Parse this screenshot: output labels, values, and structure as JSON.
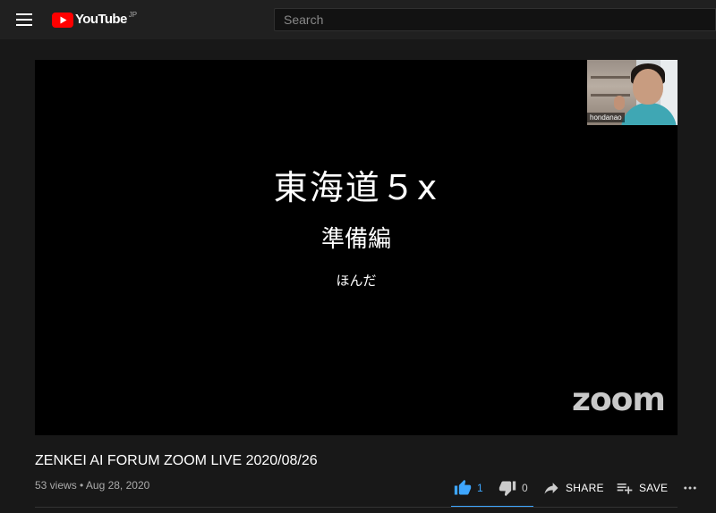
{
  "header": {
    "logo_text": "YouTube",
    "region": "JP",
    "search_placeholder": "Search"
  },
  "player": {
    "slide_title": "東海道５x",
    "slide_subtitle": "準備編",
    "slide_author": "ほんだ",
    "watermark": "zoom",
    "participant_name": "hondanao"
  },
  "video": {
    "title": "ZENKEI AI FORUM ZOOM LIVE 2020/08/26",
    "meta": "53 views • Aug 28, 2020"
  },
  "actions": {
    "like_count": "1",
    "dislike_count": "0",
    "share_label": "SHARE",
    "save_label": "SAVE"
  },
  "colors": {
    "accent": "#3ea6ff",
    "brand_red": "#ff0000",
    "background": "#181818"
  }
}
